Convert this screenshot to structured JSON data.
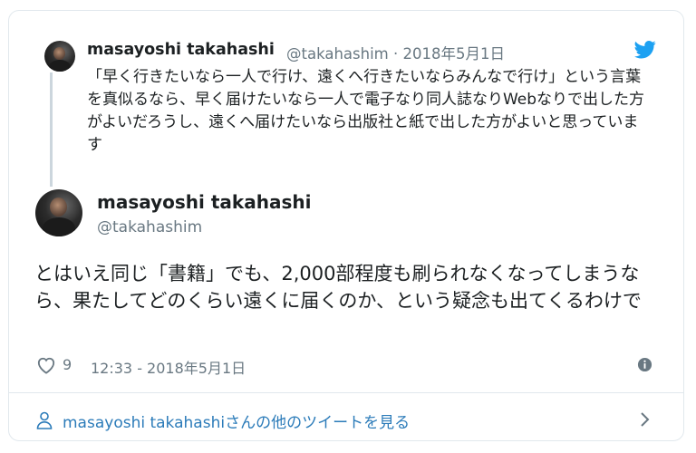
{
  "quoted": {
    "name": "masayoshi takahashi",
    "meta": "@takahashim · 2018年5月1日",
    "text": "「早く行きたいなら一人で行け、遠くへ行きたいならみんなで行け」という言葉を真似るなら、早く届けたいなら一人で電子なり同人誌なりWebなりで出した方がよいだろうし、遠くへ届けたいなら出版社と紙で出した方がよいと思っています"
  },
  "main": {
    "name": "masayoshi takahashi",
    "handle": "@takahashim",
    "text": "とはいえ同じ「書籍」でも、2,000部程度も刷られなくなってしまうなら、果たしてどのくらい遠くに届くのか、という疑念も出てくるわけで",
    "like_count": "9",
    "timestamp": "12:33 - 2018年5月1日"
  },
  "footer": {
    "more_tweets_label": "masayoshi takahashiさんの他のツイートを見る"
  },
  "icons": {
    "brand": "twitter-bird-icon",
    "like": "heart-icon",
    "info": "info-icon",
    "profile": "person-icon",
    "chevron": "chevron-right-icon"
  },
  "colors": {
    "brand_blue": "#1da1f2",
    "link_blue": "#2b7bb9",
    "muted_text": "#697882",
    "border": "#e1e8ed"
  }
}
